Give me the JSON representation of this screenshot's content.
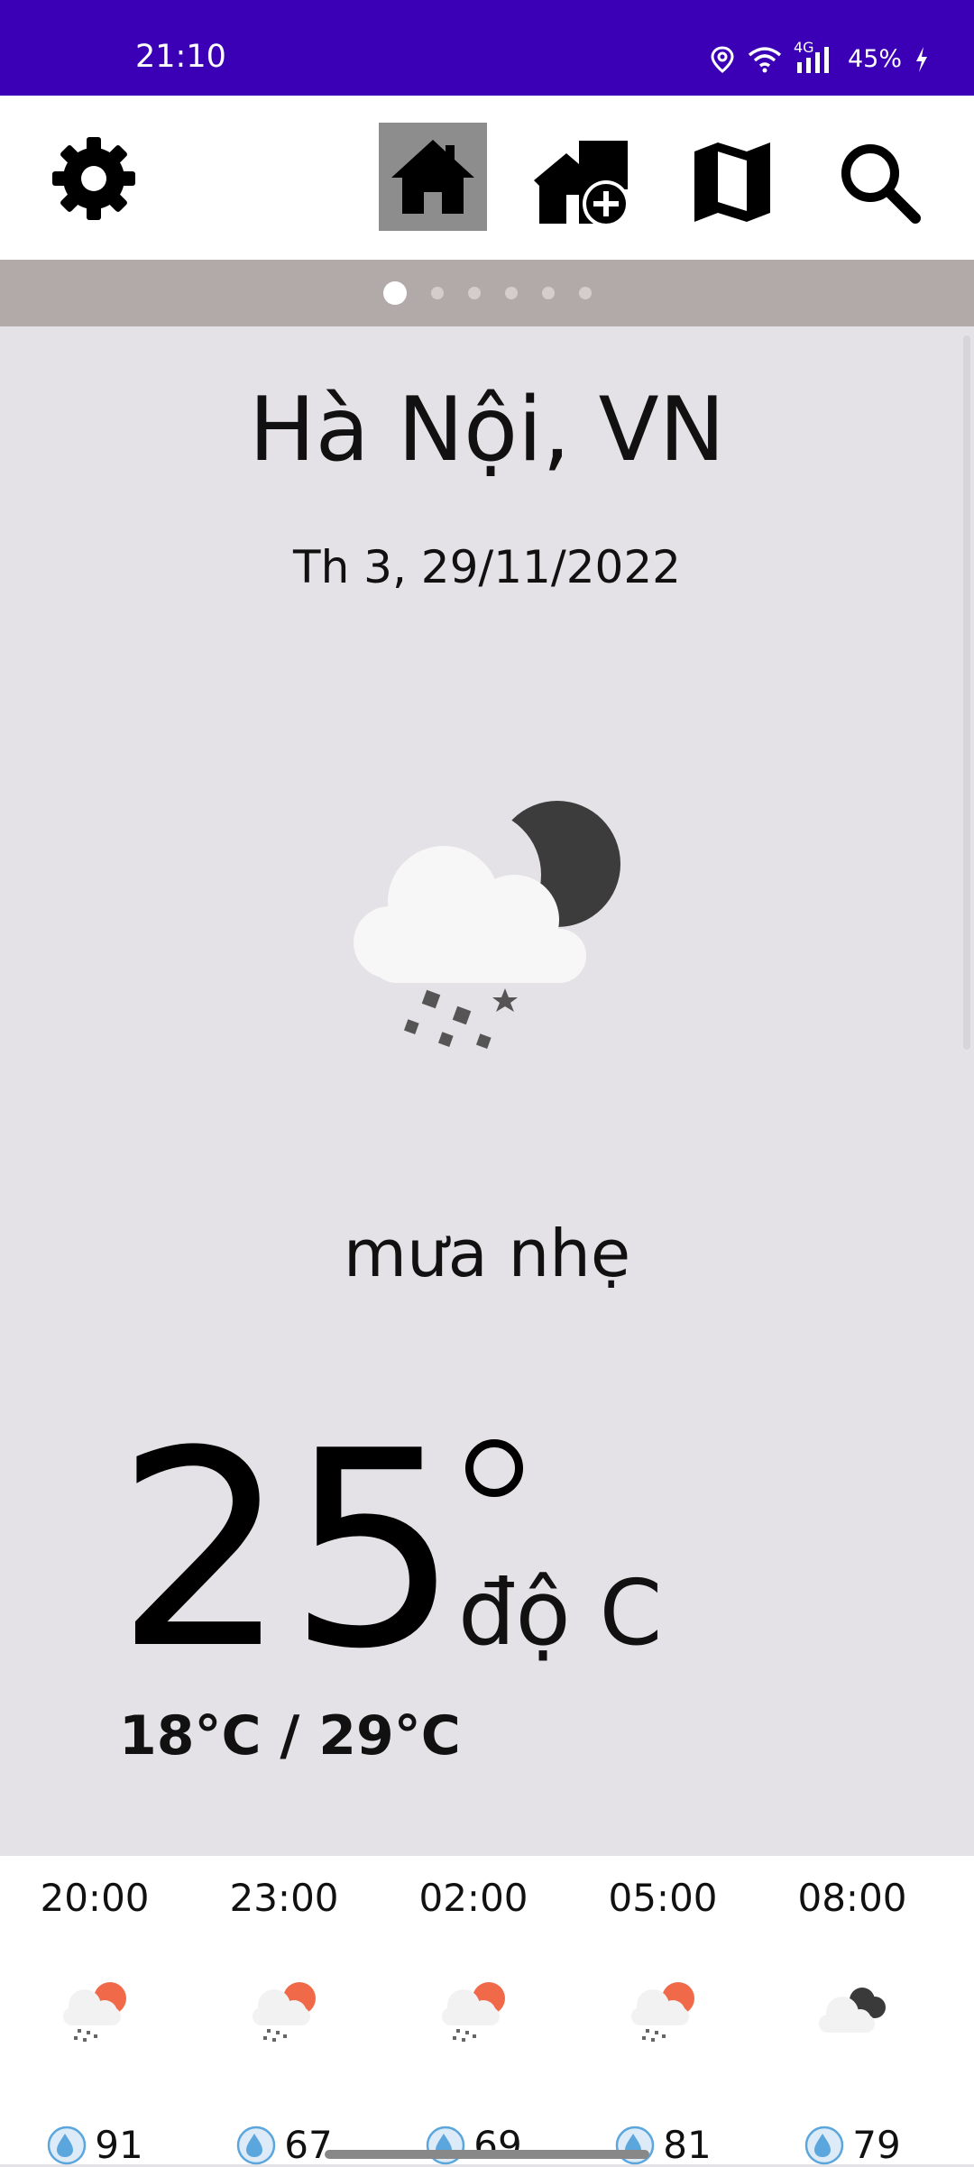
{
  "status_bar": {
    "time": "21:10",
    "network": "4G",
    "battery": "45%",
    "icons": [
      "location-icon",
      "wifi-icon",
      "signal-icon",
      "charging-icon"
    ]
  },
  "toolbar": {
    "icons": [
      "gear-icon",
      "home-icon",
      "add-location-icon",
      "map-icon",
      "search-icon"
    ]
  },
  "pager": {
    "count": 6,
    "active": 0
  },
  "weather": {
    "city": "Hà Nội, VN",
    "date": "Th 3, 29/11/2022",
    "description": "mưa nhẹ",
    "temperature": "25",
    "unit": "độ C",
    "min_max": "18°C / 29°C",
    "icon": "light-rain-night-icon"
  },
  "hourly": [
    {
      "time": "20:00",
      "humidity": "91",
      "icon": "light-rain-icon"
    },
    {
      "time": "23:00",
      "humidity": "67",
      "icon": "light-rain-icon"
    },
    {
      "time": "02:00",
      "humidity": "69",
      "icon": "light-rain-icon"
    },
    {
      "time": "05:00",
      "humidity": "81",
      "icon": "light-rain-icon"
    },
    {
      "time": "08:00",
      "humidity": "79",
      "icon": "cloudy-icon"
    }
  ],
  "colors": {
    "status_bar": "#3b00b5",
    "pager_bar": "#b2aaa9",
    "main_background": "#e4e2e6",
    "home_active": "#8d8d8d",
    "sun_accent": "#f06a4a",
    "humidity_icon": "#5aa6dd"
  }
}
